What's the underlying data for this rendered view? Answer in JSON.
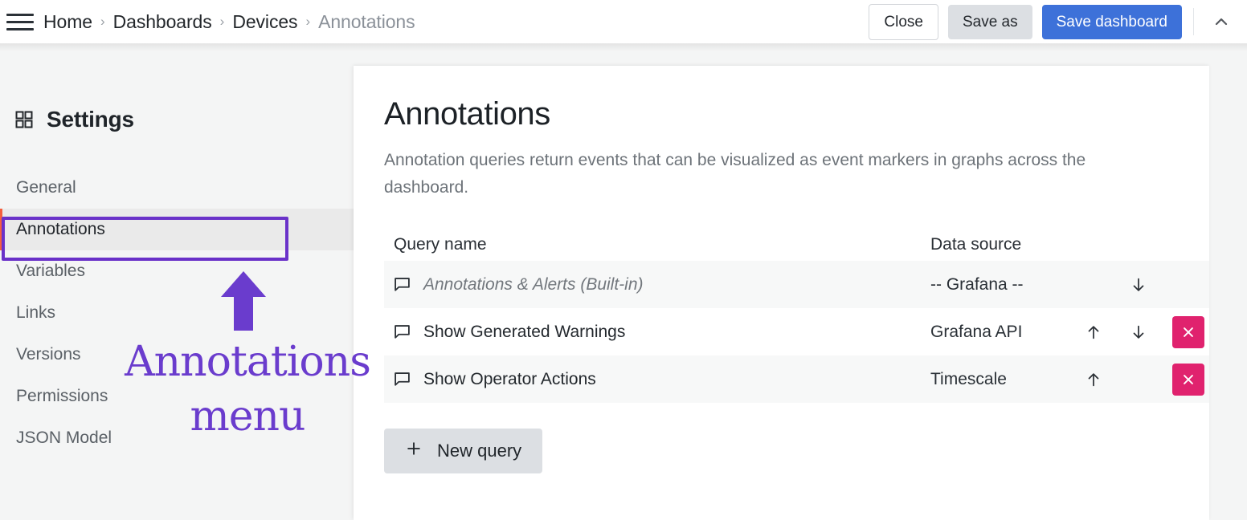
{
  "topbar": {
    "menu_icon": "hamburger-menu-icon",
    "breadcrumb": [
      {
        "label": "Home",
        "current": false
      },
      {
        "label": "Dashboards",
        "current": false
      },
      {
        "label": "Devices",
        "current": false
      },
      {
        "label": "Annotations",
        "current": true
      }
    ],
    "separator": "›",
    "close_label": "Close",
    "save_as_label": "Save as",
    "save_dashboard_label": "Save dashboard",
    "collapse_icon": "chevron-up-icon",
    "accent_primary": "#3d71d9"
  },
  "sidebar": {
    "icon": "apps-grid-icon",
    "title": "Settings",
    "active_accent": "#f55f3e",
    "items": [
      {
        "label": "General",
        "active": false
      },
      {
        "label": "Annotations",
        "active": true
      },
      {
        "label": "Variables",
        "active": false
      },
      {
        "label": "Links",
        "active": false
      },
      {
        "label": "Versions",
        "active": false
      },
      {
        "label": "Permissions",
        "active": false
      },
      {
        "label": "JSON Model",
        "active": false
      }
    ]
  },
  "main": {
    "title": "Annotations",
    "description": "Annotation queries return events that can be visualized as event markers in graphs across the dashboard.",
    "table": {
      "columns": [
        "Query name",
        "Data source"
      ],
      "rows": [
        {
          "icon": "comment-icon",
          "name": "Annotations & Alerts (Built-in)",
          "builtin": true,
          "data_source": "-- Grafana --",
          "move_up": false,
          "move_down": true,
          "deletable": false,
          "shaded": true
        },
        {
          "icon": "comment-icon",
          "name": "Show Generated Warnings",
          "builtin": false,
          "data_source": "Grafana API",
          "move_up": true,
          "move_down": true,
          "deletable": true,
          "shaded": false
        },
        {
          "icon": "comment-icon",
          "name": "Show Operator Actions",
          "builtin": false,
          "data_source": "Timescale",
          "move_up": true,
          "move_down": false,
          "deletable": true,
          "shaded": true
        }
      ],
      "move_up_icon": "arrow-up-icon",
      "move_down_icon": "arrow-down-icon",
      "delete_icon": "close-x-icon",
      "delete_color": "#e0226e"
    },
    "new_query_label": "New query",
    "new_query_icon": "plus-icon"
  },
  "annotation_overlay": {
    "color": "#6a3ccd",
    "callout_text_line1": "Annotations",
    "callout_text_line2": "menu",
    "highlight_target": "Annotations",
    "arrow_icon": "arrow-up-annotation-icon"
  }
}
